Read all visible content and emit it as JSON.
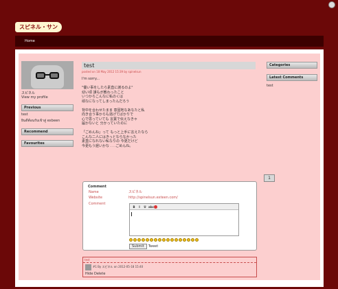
{
  "site": {
    "title": "スピネル・サン"
  },
  "nav": {
    "home": "Home"
  },
  "profile": {
    "name": "スピネル",
    "link": "View my profile"
  },
  "sidebar_left": {
    "previous_label": "Previous",
    "previous_items": [
      "test",
      "ยินดีต้อนรับเข้าสู่ exbeen"
    ],
    "recommend_label": "Recommend",
    "favourites_label": "Favourites"
  },
  "post": {
    "title": "test",
    "meta": "posted on 18 May 2012 15:39 by spinelsun",
    "body": "I'm sorry...\n\n\"優い事をしたら素直に謝るのよ\"\n幼い頃 誰もが教わったこと\nいつからこんなに私のくは\n頑なになってしまったんだろう\n\n背中を合わせたまま 意固地なあなたと私\n向き合う事からも逃げてばかりで\n心で思っていても 言葉で伝えなきゃ\n届かないと 分かっていたのに\n\n「ごめんね」って もっと上手に言えたなら\nこんな二人にはきっとならなかった\n素直になれない私なりの 今更だけど\n今更もう遅いかな . . .ごめんね。"
  },
  "pager": {
    "page": "1"
  },
  "comment_form": {
    "title": "Comment",
    "name_label": "Name",
    "name_value": "スピネル",
    "website_label": "Website",
    "website_value": "http://spinelsun.exteen.com/",
    "comment_label": "Comment",
    "toolbar": [
      "B",
      "I",
      "U",
      "abc"
    ],
    "submit": "Submit",
    "submit_extra": "Tweet"
  },
  "comment_listing": {
    "head": "test",
    "meta": "#1 By スピネル on 2012-05-18 15:40",
    "actions": "Hide Delete"
  },
  "sidebar_right": {
    "categories_label": "Categories",
    "latest_label": "Latest Comments",
    "latest_items": [
      "test"
    ]
  }
}
